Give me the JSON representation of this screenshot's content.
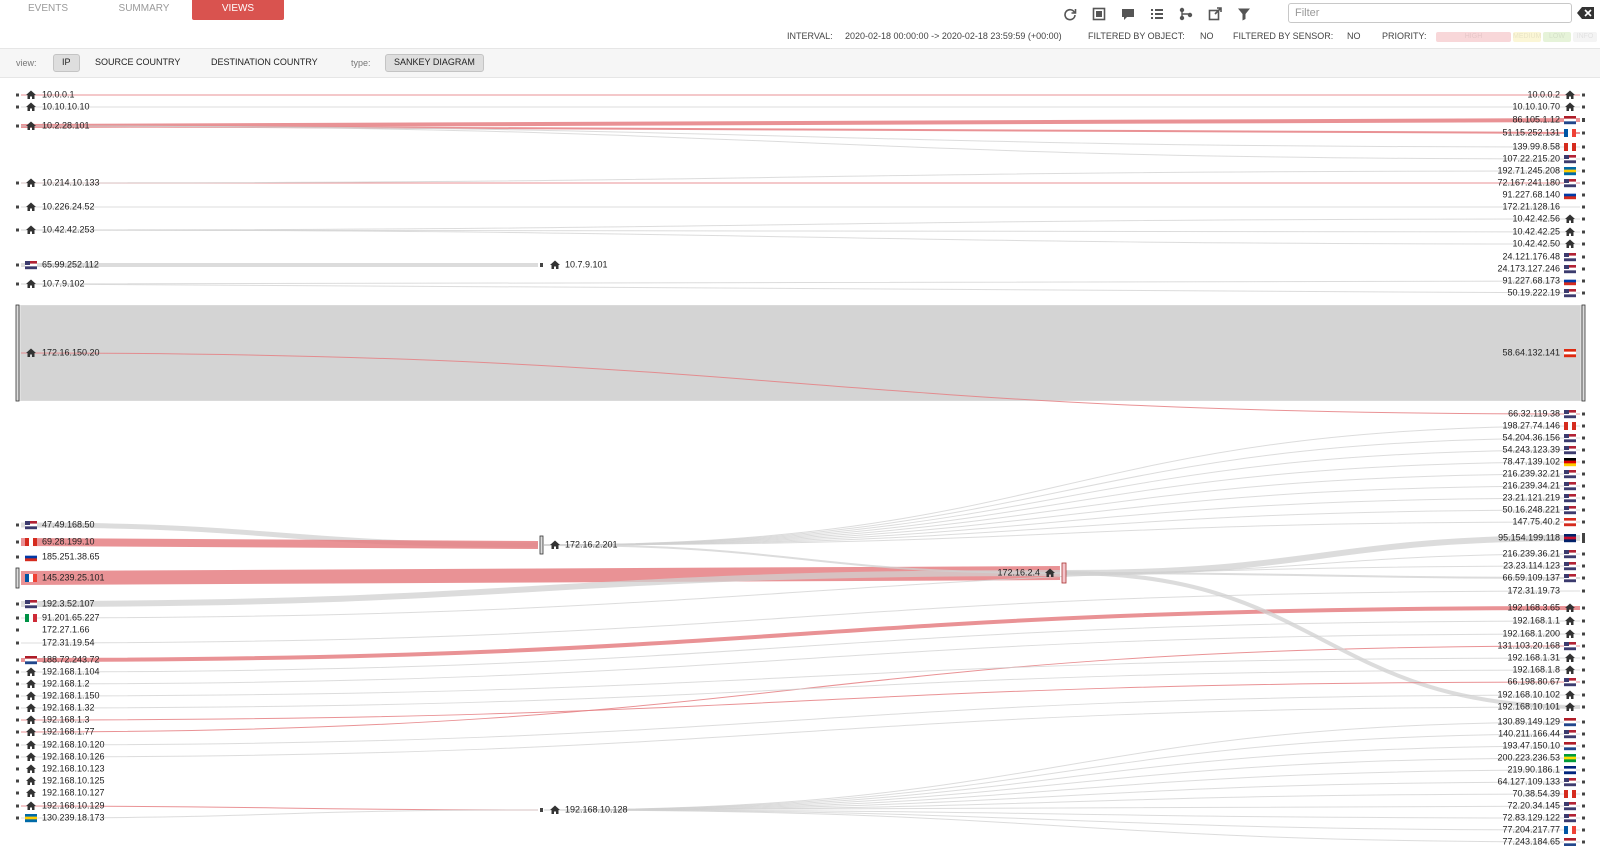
{
  "tabs": [
    {
      "label": "EVENTS",
      "active": false
    },
    {
      "label": "SUMMARY",
      "active": false
    },
    {
      "label": "VIEWS",
      "active": true
    }
  ],
  "toolbar": {
    "icons": [
      "refresh-icon",
      "fullscreen-icon",
      "comment-icon",
      "list-icon",
      "share-icon",
      "external-link-icon",
      "filter-icon"
    ],
    "filter_placeholder": "Filter",
    "clear_icon": "backspace-icon"
  },
  "status": {
    "interval_label": "INTERVAL:",
    "interval_value": "2020-02-18 00:00:00 -> 2020-02-18 23:59:59 (+00:00)",
    "filtered_object_label": "FILTERED BY OBJECT:",
    "filtered_object_value": "NO",
    "filtered_sensor_label": "FILTERED BY SENSOR:",
    "filtered_sensor_value": "NO",
    "priority_label": "PRIORITY:",
    "priority_levels": [
      {
        "label": "HIGH",
        "color": "#f8d7d9"
      },
      {
        "label": "MEDIUM",
        "color": "#fbf6d6"
      },
      {
        "label": "LOW",
        "color": "#e6f3d9"
      },
      {
        "label": "INFO",
        "color": "#f4f4f4"
      }
    ]
  },
  "viewbar": {
    "view_label": "view:",
    "view_options": [
      {
        "label": "IP",
        "selected": true
      },
      {
        "label": "SOURCE COUNTRY",
        "selected": false
      },
      {
        "label": "DESTINATION COUNTRY",
        "selected": false
      }
    ],
    "type_label": "type:",
    "type_options": [
      {
        "label": "SANKEY DIAGRAM",
        "selected": true
      }
    ]
  },
  "colors": {
    "accent": "#d9534f",
    "link_red": "#e57f83",
    "link_grey": "#d0d0d0",
    "node_highlight": "#e0e0e0"
  },
  "sankey": {
    "sources": [
      {
        "label": "10.0.0.1",
        "icon": "home-icon"
      },
      {
        "label": "10.10.10.10",
        "icon": "home-icon"
      },
      {
        "label": "10.2.28.101",
        "icon": "home-icon"
      },
      {
        "label": "10.214.10.133",
        "icon": "home-icon"
      },
      {
        "label": "10.226.24.52",
        "icon": "home-icon"
      },
      {
        "label": "10.42.42.253",
        "icon": "home-icon"
      },
      {
        "label": "65.99.252.112",
        "icon": "flag-us"
      },
      {
        "label": "10.7.9.102",
        "icon": "home-icon"
      },
      {
        "label": "172.16.150.20",
        "icon": "home-icon"
      },
      {
        "label": "47.49.168.50",
        "icon": "flag-us"
      },
      {
        "label": "69.28.199.10",
        "icon": "flag-ca"
      },
      {
        "label": "185.251.38.65",
        "icon": "flag-ru"
      },
      {
        "label": "145.239.25.101",
        "icon": "flag-fr"
      },
      {
        "label": "192.3.52.107",
        "icon": "flag-us"
      },
      {
        "label": "91.201.65.227",
        "icon": "flag-it"
      },
      {
        "label": "172.27.1.66",
        "icon": "none"
      },
      {
        "label": "172.31.19.54",
        "icon": "none"
      },
      {
        "label": "188.72.243.72",
        "icon": "flag-nl"
      },
      {
        "label": "192.168.1.104",
        "icon": "home-icon"
      },
      {
        "label": "192.168.1.2",
        "icon": "home-icon"
      },
      {
        "label": "192.168.1.150",
        "icon": "home-icon"
      },
      {
        "label": "192.168.1.32",
        "icon": "home-icon"
      },
      {
        "label": "192.168.1.3",
        "icon": "home-icon"
      },
      {
        "label": "192.168.1.77",
        "icon": "home-icon"
      },
      {
        "label": "192.168.10.120",
        "icon": "home-icon"
      },
      {
        "label": "192.168.10.126",
        "icon": "home-icon"
      },
      {
        "label": "192.168.10.123",
        "icon": "home-icon"
      },
      {
        "label": "192.168.10.125",
        "icon": "home-icon"
      },
      {
        "label": "192.168.10.127",
        "icon": "home-icon"
      },
      {
        "label": "192.168.10.129",
        "icon": "home-icon"
      },
      {
        "label": "130.239.18.173",
        "icon": "flag-se"
      }
    ],
    "middle": [
      {
        "label": "10.7.9.101",
        "icon": "home-icon"
      },
      {
        "label": "172.16.2.201",
        "icon": "home-icon"
      },
      {
        "label": "172.16.2.4",
        "icon": "home-icon"
      },
      {
        "label": "192.168.10.128",
        "icon": "home-icon"
      }
    ],
    "targets": [
      {
        "label": "10.0.0.2",
        "icon": "home-icon"
      },
      {
        "label": "10.10.10.70",
        "icon": "home-icon"
      },
      {
        "label": "86.105.1.12",
        "icon": "flag-nl"
      },
      {
        "label": "51.15.252.131",
        "icon": "flag-fr"
      },
      {
        "label": "139.99.8.58",
        "icon": "flag-ca"
      },
      {
        "label": "107.22.215.20",
        "icon": "flag-us"
      },
      {
        "label": "192.71.245.208",
        "icon": "flag-se"
      },
      {
        "label": "72.167.241.180",
        "icon": "flag-us"
      },
      {
        "label": "91.227.68.140",
        "icon": "flag-ru"
      },
      {
        "label": "172.21.128.16",
        "icon": "none"
      },
      {
        "label": "10.42.42.56",
        "icon": "home-icon"
      },
      {
        "label": "10.42.42.25",
        "icon": "home-icon"
      },
      {
        "label": "10.42.42.50",
        "icon": "home-icon"
      },
      {
        "label": "24.121.176.48",
        "icon": "flag-us"
      },
      {
        "label": "24.173.127.246",
        "icon": "flag-us"
      },
      {
        "label": "91.227.68.173",
        "icon": "flag-ru"
      },
      {
        "label": "50.19.222.19",
        "icon": "flag-us"
      },
      {
        "label": "58.64.132.141",
        "icon": "flag-hk"
      },
      {
        "label": "66.32.119.38",
        "icon": "flag-us"
      },
      {
        "label": "198.27.74.146",
        "icon": "flag-ca"
      },
      {
        "label": "54.204.36.156",
        "icon": "flag-us"
      },
      {
        "label": "54.243.123.39",
        "icon": "flag-us"
      },
      {
        "label": "78.47.139.102",
        "icon": "flag-de"
      },
      {
        "label": "216.239.32.21",
        "icon": "flag-us"
      },
      {
        "label": "216.239.34.21",
        "icon": "flag-us"
      },
      {
        "label": "23.21.121.219",
        "icon": "flag-us"
      },
      {
        "label": "50.16.248.221",
        "icon": "flag-us"
      },
      {
        "label": "147.75.40.2",
        "icon": "flag-ch"
      },
      {
        "label": "95.154.199.118",
        "icon": "flag-gb"
      },
      {
        "label": "216.239.36.21",
        "icon": "flag-us"
      },
      {
        "label": "23.23.114.123",
        "icon": "flag-us"
      },
      {
        "label": "66.59.109.137",
        "icon": "flag-us"
      },
      {
        "label": "172.31.19.73",
        "icon": "none"
      },
      {
        "label": "192.168.3.65",
        "icon": "home-icon"
      },
      {
        "label": "192.168.1.1",
        "icon": "home-icon"
      },
      {
        "label": "192.168.1.200",
        "icon": "home-icon"
      },
      {
        "label": "131.103.20.168",
        "icon": "flag-us"
      },
      {
        "label": "192.168.1.31",
        "icon": "home-icon"
      },
      {
        "label": "192.168.1.8",
        "icon": "home-icon"
      },
      {
        "label": "66.198.80.67",
        "icon": "flag-us"
      },
      {
        "label": "192.168.10.102",
        "icon": "home-icon"
      },
      {
        "label": "192.168.10.101",
        "icon": "home-icon"
      },
      {
        "label": "130.89.149.129",
        "icon": "flag-nl"
      },
      {
        "label": "140.211.166.44",
        "icon": "flag-us"
      },
      {
        "label": "193.47.150.10",
        "icon": "flag-nl"
      },
      {
        "label": "200.223.236.53",
        "icon": "flag-br"
      },
      {
        "label": "219.90.186.1",
        "icon": "flag-au"
      },
      {
        "label": "64.127.109.133",
        "icon": "flag-us"
      },
      {
        "label": "70.38.54.39",
        "icon": "flag-ca"
      },
      {
        "label": "72.20.34.145",
        "icon": "flag-us"
      },
      {
        "label": "72.83.129.122",
        "icon": "flag-us"
      },
      {
        "label": "77.204.217.77",
        "icon": "flag-fr"
      },
      {
        "label": "77.243.184.65",
        "icon": "flag-nl"
      }
    ],
    "links": [
      {
        "from": "s0",
        "to": "t0",
        "color": "red",
        "weight": 1
      },
      {
        "from": "s1",
        "to": "t1",
        "color": "grey",
        "weight": 1
      },
      {
        "from": "s2",
        "to": "t2",
        "color": "red",
        "weight": 4
      },
      {
        "from": "s2",
        "to": "t3",
        "color": "red",
        "weight": 2
      },
      {
        "from": "s2",
        "to": "t4",
        "color": "grey",
        "weight": 1
      },
      {
        "from": "s2",
        "to": "t5",
        "color": "grey",
        "weight": 1
      },
      {
        "from": "s3",
        "to": "t7",
        "color": "red",
        "weight": 1
      },
      {
        "from": "s3",
        "to": "t6",
        "color": "grey",
        "weight": 1
      },
      {
        "from": "s5",
        "to": "t10",
        "color": "grey",
        "weight": 1
      },
      {
        "from": "s5",
        "to": "t11",
        "color": "grey",
        "weight": 1
      },
      {
        "from": "s5",
        "to": "t12",
        "color": "grey",
        "weight": 1
      },
      {
        "from": "s6",
        "to": "m0",
        "color": "grey",
        "weight": 4
      },
      {
        "from": "s7",
        "to": "t15",
        "color": "grey",
        "weight": 1
      },
      {
        "from": "s7",
        "to": "t16",
        "color": "grey",
        "weight": 1
      },
      {
        "from": "s8",
        "to": "t17",
        "color": "grey",
        "weight": 95
      },
      {
        "from": "s8",
        "to": "t18",
        "color": "red",
        "weight": 1
      },
      {
        "from": "s9",
        "to": "m1",
        "color": "grey",
        "weight": 5
      },
      {
        "from": "s10",
        "to": "m1",
        "color": "red",
        "weight": 8
      },
      {
        "from": "s12",
        "to": "m2",
        "color": "red",
        "weight": 14
      },
      {
        "from": "s13",
        "to": "m2",
        "color": "grey",
        "weight": 6
      },
      {
        "from": "s17",
        "to": "t33",
        "color": "red",
        "weight": 4
      },
      {
        "from": "s23",
        "to": "t36",
        "color": "red",
        "weight": 1
      },
      {
        "from": "s29",
        "to": "m3",
        "color": "red",
        "weight": 1
      },
      {
        "from": "s30",
        "to": "m3",
        "color": "grey",
        "weight": 1
      },
      {
        "from": "m2",
        "to": "t28",
        "color": "grey",
        "weight": 6
      },
      {
        "from": "m2",
        "to": "t31",
        "color": "grey",
        "weight": 2
      },
      {
        "from": "m2",
        "to": "t41",
        "color": "grey",
        "weight": 4
      },
      {
        "from": "m2",
        "to": "t29",
        "color": "grey",
        "weight": 1
      },
      {
        "from": "m1",
        "to": "t19",
        "color": "grey",
        "weight": 1
      },
      {
        "from": "m1",
        "to": "t20",
        "color": "grey",
        "weight": 1
      },
      {
        "from": "m1",
        "to": "t21",
        "color": "grey",
        "weight": 1
      },
      {
        "from": "m1",
        "to": "t22",
        "color": "grey",
        "weight": 1
      },
      {
        "from": "m1",
        "to": "t23",
        "color": "grey",
        "weight": 1
      },
      {
        "from": "m1",
        "to": "t24",
        "color": "grey",
        "weight": 1
      },
      {
        "from": "m1",
        "to": "t25",
        "color": "grey",
        "weight": 1
      },
      {
        "from": "m1",
        "to": "t26",
        "color": "grey",
        "weight": 1
      },
      {
        "from": "m1",
        "to": "t27",
        "color": "grey",
        "weight": 1
      },
      {
        "from": "m1",
        "to": "m2",
        "color": "grey",
        "weight": 2
      },
      {
        "from": "m3",
        "to": "t42",
        "color": "grey",
        "weight": 1
      },
      {
        "from": "m3",
        "to": "t43",
        "color": "grey",
        "weight": 1
      },
      {
        "from": "m3",
        "to": "t44",
        "color": "grey",
        "weight": 1
      },
      {
        "from": "m3",
        "to": "t45",
        "color": "grey",
        "weight": 1
      },
      {
        "from": "m3",
        "to": "t46",
        "color": "grey",
        "weight": 1
      },
      {
        "from": "m3",
        "to": "t47",
        "color": "grey",
        "weight": 1
      },
      {
        "from": "m3",
        "to": "t48",
        "color": "grey",
        "weight": 1
      },
      {
        "from": "m3",
        "to": "t49",
        "color": "grey",
        "weight": 1
      },
      {
        "from": "m3",
        "to": "t50",
        "color": "grey",
        "weight": 1
      },
      {
        "from": "m3",
        "to": "t51",
        "color": "grey",
        "weight": 1
      },
      {
        "from": "m3",
        "to": "t52",
        "color": "grey",
        "weight": 1
      },
      {
        "from": "s18",
        "to": "t34",
        "color": "grey",
        "weight": 1
      },
      {
        "from": "s19",
        "to": "t35",
        "color": "grey",
        "weight": 1
      },
      {
        "from": "s20",
        "to": "t37",
        "color": "grey",
        "weight": 1
      },
      {
        "from": "s21",
        "to": "t38",
        "color": "grey",
        "weight": 1
      },
      {
        "from": "s22",
        "to": "t39",
        "color": "red",
        "weight": 1
      },
      {
        "from": "s24",
        "to": "t40",
        "color": "grey",
        "weight": 1
      },
      {
        "from": "s25",
        "to": "t41",
        "color": "grey",
        "weight": 1
      },
      {
        "from": "s16",
        "to": "t32",
        "color": "grey",
        "weight": 1
      },
      {
        "from": "s14",
        "to": "t30",
        "color": "grey",
        "weight": 1
      },
      {
        "from": "s4",
        "to": "t9",
        "color": "grey",
        "weight": 1
      }
    ]
  }
}
